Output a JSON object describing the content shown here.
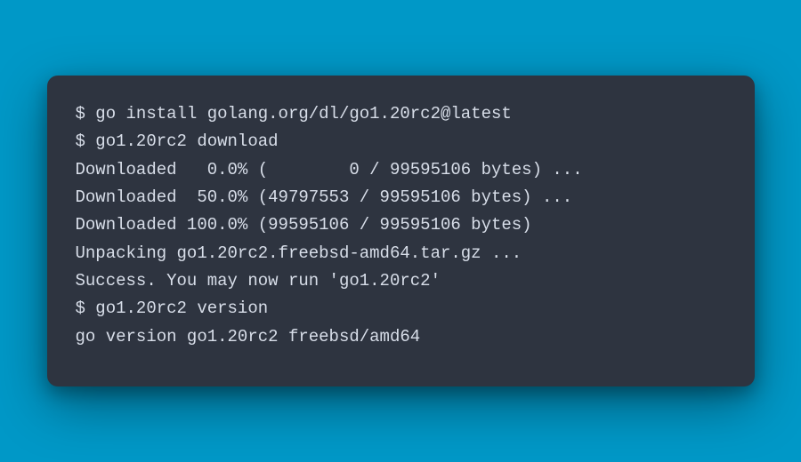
{
  "terminal": {
    "lines": [
      "$ go install golang.org/dl/go1.20rc2@latest",
      "$ go1.20rc2 download",
      "Downloaded   0.0% (        0 / 99595106 bytes) ...",
      "Downloaded  50.0% (49797553 / 99595106 bytes) ...",
      "Downloaded 100.0% (99595106 / 99595106 bytes)",
      "Unpacking go1.20rc2.freebsd-amd64.tar.gz ...",
      "Success. You may now run 'go1.20rc2'",
      "$ go1.20rc2 version",
      "go version go1.20rc2 freebsd/amd64"
    ]
  }
}
